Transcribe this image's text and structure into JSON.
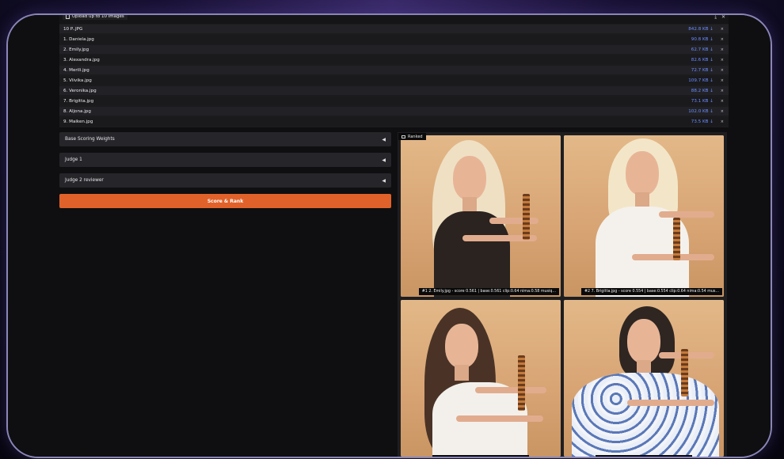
{
  "upload": {
    "label": "Upload up to 10 images"
  },
  "files": [
    {
      "name": "10 P..JPG",
      "size": "842.8 KB ↓"
    },
    {
      "name": "1. Daniela.jpg",
      "size": "90.8 KB ↓"
    },
    {
      "name": "2. Emily.jpg",
      "size": "62.7 KB ↓"
    },
    {
      "name": "3. Alexandra.jpg",
      "size": "82.6 KB ↓"
    },
    {
      "name": "4. Merili.jpg",
      "size": "72.7 KB ↓"
    },
    {
      "name": "5. Viivika.jpg",
      "size": "109.7 KB ↓"
    },
    {
      "name": "6. Veronika.jpg",
      "size": "88.2 KB ↓"
    },
    {
      "name": "7. Brigitta.jpg",
      "size": "73.1 KB ↓"
    },
    {
      "name": "8. Aljona.jpg",
      "size": "102.0 KB ↓"
    },
    {
      "name": "9. Maiken.jpg",
      "size": "73.5 KB ↓"
    }
  ],
  "remove_glyph": "×",
  "accordions": [
    {
      "label": "Base Scoring Weights",
      "caret": "◀"
    },
    {
      "label": "Judge 1",
      "caret": "◀"
    },
    {
      "label": "Judge 2 reviewer",
      "caret": "◀"
    }
  ],
  "actions": {
    "score_rank": "Score & Rank"
  },
  "gallery": {
    "badge": "Ranked",
    "captions": [
      "#1 2. Emily.jpg - score 0.561 | base:0.561 clip:0.64 nima:0.58 musiq...",
      "#2 7. Brigitta.jpg - score 0.554 | base:0.554 clip:0.64 nima:0.54 mus..."
    ]
  },
  "colors": {
    "accent": "#e0622a",
    "link": "#6b8cff",
    "background": "#0f0f11"
  }
}
